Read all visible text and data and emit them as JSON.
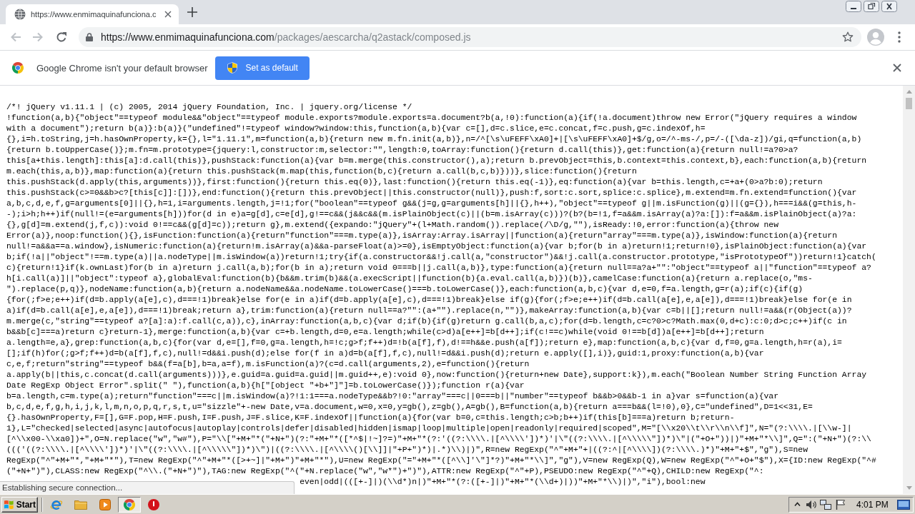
{
  "tabs": [
    {
      "title": "https://www.enmimaquinafunciona.c",
      "selected": true
    }
  ],
  "toolbar": {
    "back": {
      "disabled": true
    },
    "forward": {
      "disabled": true
    },
    "url": "https://www.enmimaquinafunciona.com/packages/aescarcha/q2astack/composed.js"
  },
  "infobar": {
    "message": "Google Chrome isn't your default browser",
    "button": "Set as default"
  },
  "code": {
    "lines": [
      "/*! jQuery v1.11.1 | (c) 2005, 2014 jQuery Foundation, Inc. | jquery.org/license */",
      "!function(a,b){\"object\"==typeof module&&\"object\"==typeof module.exports?module.exports=a.document?b(a,!0):function(a){if(!a.document)throw new Error(\"jQuery requires a window",
      "with a document\");return b(a)}:b(a)}(\"undefined\"!=typeof window?window:this,function(a,b){var c=[],d=c.slice,e=c.concat,f=c.push,g=c.indexOf,h=",
      "{},i=h.toString,j=h.hasOwnProperty,k={},l=\"1.11.1\",m=function(a,b){return new m.fn.init(a,b)},n=/^[\\s\\uFEFF\\xA0]+|[\\s\\uFEFF\\xA0]+$/g,o=/^-ms-/,p=/-([\\da-z])/gi,q=function(a,b)",
      "{return b.toUpperCase()};m.fn=m.prototype={jquery:l,constructor:m,selector:\"\",length:0,toArray:function(){return d.call(this)},get:function(a){return null!=a?0>a?",
      "this[a+this.length]:this[a]:d.call(this)},pushStack:function(a){var b=m.merge(this.constructor(),a);return b.prevObject=this,b.context=this.context,b},each:function(a,b){return",
      "m.each(this,a,b)},map:function(a){return this.pushStack(m.map(this,function(b,c){return a.call(b,c,b)}))},slice:function(){return",
      "this.pushStack(d.apply(this,arguments))},first:function(){return this.eq(0)},last:function(){return this.eq(-1)},eq:function(a){var b=this.length,c=+a+(0>a?b:0);return",
      "this.pushStack(c>=0&&b>c?[this[c]]:[])},end:function(){return this.prevObject||this.constructor(null)},push:f,sort:c.sort,splice:c.splice},m.extend=m.fn.extend=function(){var",
      "a,b,c,d,e,f,g=arguments[0]||{},h=1,i=arguments.length,j=!1;for(\"boolean\"==typeof g&&(j=g,g=arguments[h]||{},h++),\"object\"==typeof g||m.isFunction(g)||(g={}),h===i&&(g=this,h-",
      "-);i>h;h++)if(null!=(e=arguments[h]))for(d in e)a=g[d],c=e[d],g!==c&&(j&&c&&(m.isPlainObject(c)||(b=m.isArray(c)))?(b?(b=!1,f=a&&m.isArray(a)?a:[]):f=a&&m.isPlainObject(a)?a:",
      "{},g[d]=m.extend(j,f,c)):void 0!==c&&(g[d]=c));return g},m.extend({expando:\"jQuery\"+(l+Math.random()).replace(/\\D/g,\"\"),isReady:!0,error:function(a){throw new",
      "Error(a)},noop:function(){},isFunction:function(a){return\"function\"===m.type(a)},isArray:Array.isArray||function(a){return\"array\"===m.type(a)},isWindow:function(a){return",
      "null!=a&&a==a.window},isNumeric:function(a){return!m.isArray(a)&&a-parseFloat(a)>=0},isEmptyObject:function(a){var b;for(b in a)return!1;return!0},isPlainObject:function(a){var",
      "b;if(!a||\"object\"!==m.type(a)||a.nodeType||m.isWindow(a))return!1;try{if(a.constructor&&!j.call(a,\"constructor\")&&!j.call(a.constructor.prototype,\"isPrototypeOf\"))return!1}catch(",
      "c){return!1}if(k.ownLast)for(b in a)return j.call(a,b);for(b in a);return void 0===b||j.call(a,b)},type:function(a){return null==a?a+\"\":\"object\"==typeof a||\"function\"==typeof a?",
      "h[i.call(a)]||\"object\":typeof a},globalEval:function(b){b&&m.trim(b)&&(a.execScript||function(b){a.eval.call(a,b)})(b)},camelCase:function(a){return a.replace(o,\"ms-",
      "\").replace(p,q)},nodeName:function(a,b){return a.nodeName&&a.nodeName.toLowerCase()===b.toLowerCase()},each:function(a,b,c){var d,e=0,f=a.length,g=r(a);if(c){if(g)",
      "{for(;f>e;e++)if(d=b.apply(a[e],c),d===!1)break}else for(e in a)if(d=b.apply(a[e],c),d===!1)break}else if(g){for(;f>e;e++)if(d=b.call(a[e],e,a[e]),d===!1)break}else for(e in",
      "a)if(d=b.call(a[e],e,a[e]),d===!1)break;return a},trim:function(a){return null==a?\"\":(a+\"\").replace(n,\"\")},makeArray:function(a,b){var c=b||[];return null!=a&&(r(Object(a))?",
      "m.merge(c,\"string\"==typeof a?[a]:a):f.call(c,a)),c},inArray:function(a,b,c){var d;if(b){if(g)return g.call(b,a,c);for(d=b.length,c=c?0>c?Math.max(0,d+c):c:0;d>c;c++)if(c in",
      "b&&b[c]===a)return c}return-1},merge:function(a,b){var c=+b.length,d=0,e=a.length;while(c>d)a[e++]=b[d++];if(c!==c)while(void 0!==b[d])a[e++]=b[d++];return",
      "a.length=e,a},grep:function(a,b,c){for(var d,e=[],f=0,g=a.length,h=!c;g>f;f++)d=!b(a[f],f),d!==h&&e.push(a[f]);return e},map:function(a,b,c){var d,f=0,g=a.length,h=r(a),i=",
      "[];if(h)for(;g>f;f++)d=b(a[f],f,c),null!=d&&i.push(d);else for(f in a)d=b(a[f],f,c),null!=d&&i.push(d);return e.apply([],i)},guid:1,proxy:function(a,b){var",
      "c,e,f;return\"string\"==typeof b&&(f=a[b],b=a,a=f),m.isFunction(a)?(c=d.call(arguments,2),e=function(){return",
      "a.apply(b||this,c.concat(d.call(arguments)))},e.guid=a.guid=a.guid||m.guid++,e):void 0},now:function(){return+new Date},support:k}),m.each(\"Boolean Number String Function Array",
      "Date RegExp Object Error\".split(\" \"),function(a,b){h[\"[object \"+b+\"]\"]=b.toLowerCase()});function r(a){var",
      "b=a.length,c=m.type(a);return\"function\"===c||m.isWindow(a)?!1:1===a.nodeType&&b?!0:\"array\"===c||0===b||\"number\"==typeof b&&b>0&&b-1 in a}var s=function(a){var",
      "b,c,d,e,f,g,h,i,j,k,l,m,n,o,p,q,r,s,t,u=\"sizzle\"+-new Date,v=a.document,w=0,x=0,y=gb(),z=gb(),A=gb(),B=function(a,b){return a===b&&(l=!0),0},C=\"undefined\",D=1<<31,E=",
      "{}.hasOwnProperty,F=[],G=F.pop,H=F.push,I=F.push,J=F.slice,K=F.indexOf||function(a){for(var b=0,c=this.length;c>b;b++)if(this[b]===a)return b;return-",
      "1},L=\"checked|selected|async|autofocus|autoplay|controls|defer|disabled|hidden|ismap|loop|multiple|open|readonly|required|scoped\",M=\"[\\\\x20\\\\t\\\\r\\\\n\\\\f]\",N=\"(?:\\\\\\\\.|[\\\\w-]|",
      "[^\\\\x00-\\\\xa0])+\",O=N.replace(\"w\",\"w#\"),P=\"\\\\[\"+M+\"*(\"+N+\")(?:\"+M+\"*([*^$|!~]?=)\"+M+\"*(?:'((?:\\\\\\\\.|[^\\\\\\\\'])*)'|\\\"((?:\\\\\\\\.|[^\\\\\\\\\\\"])*)\\\"|(\"+O+\"))|)\"+M+\"*\\\\]\",Q=\":(\"+N+\")(?:\\\\",
      "((('((?:\\\\\\\\.|[^\\\\\\\\'])*)'|\\\"((?:\\\\\\\\.|[^\\\\\\\\\\\"])*)\\\")|((?:\\\\\\\\.|[^\\\\\\\\()[\\\\]]|\"+P+\")*)|.*)\\\\)|)\",R=new RegExp(\"^\"+M+\"+|((?:^|[^\\\\\\\\])(?:\\\\\\\\.)*)\"+M+\"+$\",\"g\"),S=new",
      "RegExp(\"^\"+M+\"*,\"+M+\"*\"),T=new RegExp(\"^\"+M+\"*([>+~]|\"+M+\")\"+M+\"*\"),U=new RegExp(\"=\"+M+\"*([^\\\\]'\\\"]*?)\"+M+\"*\\\\]\",\"g\"),V=new RegExp(Q),W=new RegExp(\"^\"+O+\"$\"),X={ID:new RegExp(\"^#",
      "(\"+N+\")\"),CLASS:new RegExp(\"^\\\\.(\"+N+\")\"),TAG:new RegExp(\"^(\"+N.replace(\"w\",\"w*\")+\")\"),ATTR:new RegExp(\"^\"+P),PSEUDO:new RegExp(\"^\"+Q),CHILD:new RegExp(\"^:"
    ],
    "covered_line": "even|odd|(([+-]|)(\\\\d*)n|)\"+M+\"*(?:([+-]|)\"+M+\"*(\\\\d+)|))\"+M+\"*\\\\)|)\",\"i\"),bool:new"
  },
  "status_bubble": "Establishing secure connection...",
  "taskbar": {
    "start": "Start",
    "apps": [
      {
        "kind": "ie",
        "selected": false
      },
      {
        "kind": "folder",
        "selected": false
      },
      {
        "kind": "media",
        "selected": false
      },
      {
        "kind": "chrome",
        "selected": true
      },
      {
        "kind": "stop",
        "selected": false
      }
    ],
    "clock": "4:01 PM"
  }
}
